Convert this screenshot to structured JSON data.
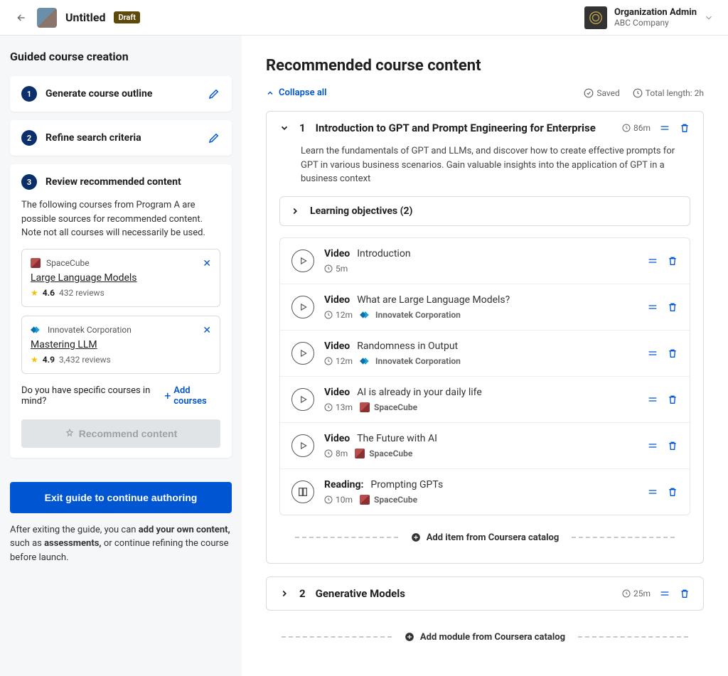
{
  "header": {
    "title": "Untitled",
    "badge": "Draft",
    "org_role": "Organization Admin",
    "org_name": "ABC Company"
  },
  "sidebar": {
    "heading": "Guided course creation",
    "steps": [
      {
        "num": "1",
        "title": "Generate course outline"
      },
      {
        "num": "2",
        "title": "Refine search criteria"
      },
      {
        "num": "3",
        "title": "Review recommended content"
      }
    ],
    "step3_desc": "The following courses from Program A are possible sources for recommended content. Note not all courses will necessarily be used.",
    "sources": [
      {
        "provider": "SpaceCube",
        "provider_type": "cube",
        "title": "Large Language Models",
        "rating": "4.6",
        "reviews": "432 reviews"
      },
      {
        "provider": "Innovatek Corporation",
        "provider_type": "inno",
        "title": "Mastering LLM",
        "rating": "4.9",
        "reviews": "3,432 reviews"
      }
    ],
    "add_question": "Do you have specific courses in mind?",
    "add_link": "Add courses",
    "recommend_label": "Recommend content",
    "exit_label": "Exit guide to continue authoring",
    "note_prefix": "After exiting the guide, you can ",
    "note_bold1": "add your own content,",
    "note_mid": " such as ",
    "note_bold2": "assessments,",
    "note_suffix": " or continue refining the course before launch."
  },
  "main": {
    "heading": "Recommended course content",
    "collapse_label": "Collapse all",
    "saved_label": "Saved",
    "total_length": "Total length: 2h",
    "modules": [
      {
        "num": "1",
        "title": "Introduction to GPT and Prompt Engineering for Enterprise",
        "duration": "86m",
        "expanded": true,
        "desc": "Learn the fundamentals of GPT and LLMs, and discover how to create effective prompts for GPT in various business scenarios. Gain valuable insights into the application of GPT in a business context",
        "objectives": "Learning objectives (2)",
        "items": [
          {
            "type": "Video",
            "title": "Introduction",
            "duration": "5m",
            "provider": "",
            "provider_type": ""
          },
          {
            "type": "Video",
            "title": "What are Large Language Models?",
            "duration": "12m",
            "provider": "Innovatek Corporation",
            "provider_type": "inno"
          },
          {
            "type": "Video",
            "title": "Randomness in Output",
            "duration": "12m",
            "provider": "Innovatek Corporation",
            "provider_type": "inno"
          },
          {
            "type": "Video",
            "title": "AI is already in your daily life",
            "duration": "13m",
            "provider": "SpaceCube",
            "provider_type": "cube"
          },
          {
            "type": "Video",
            "title": "The Future with AI",
            "duration": "8m",
            "provider": "SpaceCube",
            "provider_type": "cube"
          },
          {
            "type": "Reading:",
            "title": "Prompting GPTs",
            "duration": "10m",
            "provider": "SpaceCube",
            "provider_type": "cube"
          }
        ],
        "add_item_label": "Add item from Coursera catalog"
      },
      {
        "num": "2",
        "title": "Generative Models",
        "duration": "25m",
        "expanded": false
      }
    ],
    "add_module_label": "Add module from Coursera catalog"
  }
}
